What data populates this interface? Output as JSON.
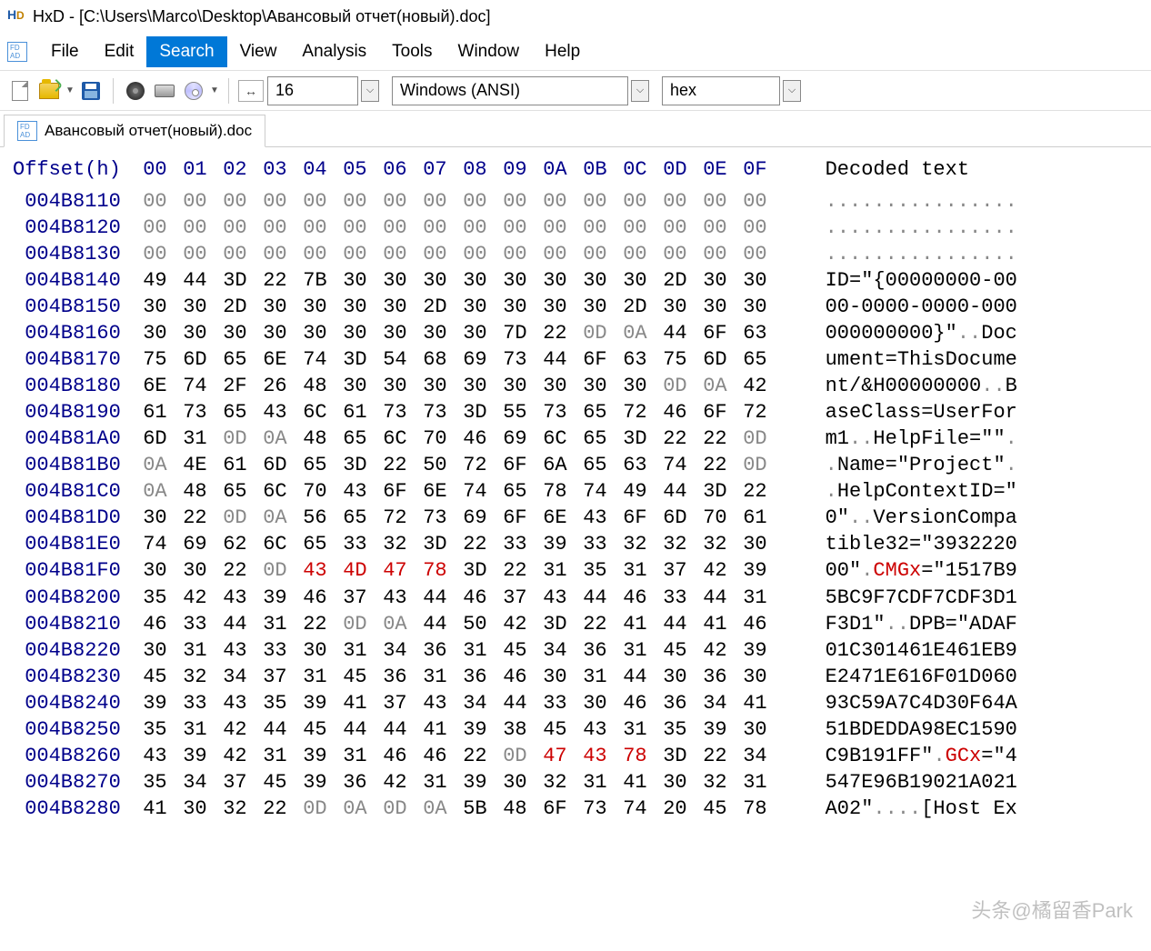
{
  "title": "HxD - [C:\\Users\\Marco\\Desktop\\Авансовый отчет(новый).doc]",
  "menu": {
    "file": "File",
    "edit": "Edit",
    "search": "Search",
    "view": "View",
    "analysis": "Analysis",
    "tools": "Tools",
    "window": "Window",
    "help": "Help"
  },
  "toolbar": {
    "bytewidth": "16",
    "encoding": "Windows (ANSI)",
    "base": "hex"
  },
  "tab": {
    "name": "Авансовый отчет(новый).doc"
  },
  "hex": {
    "offset_label": "Offset(h)",
    "columns": [
      "00",
      "01",
      "02",
      "03",
      "04",
      "05",
      "06",
      "07",
      "08",
      "09",
      "0A",
      "0B",
      "0C",
      "0D",
      "0E",
      "0F"
    ],
    "decoded_label": "Decoded text",
    "rows": [
      {
        "off": "004B8110",
        "b": [
          "00",
          "00",
          "00",
          "00",
          "00",
          "00",
          "00",
          "00",
          "00",
          "00",
          "00",
          "00",
          "00",
          "00",
          "00",
          "00"
        ],
        "d": [
          [
            ".",
            1
          ],
          [
            ".",
            1
          ],
          [
            ".",
            1
          ],
          [
            ".",
            1
          ],
          [
            ".",
            1
          ],
          [
            ".",
            1
          ],
          [
            ".",
            1
          ],
          [
            ".",
            1
          ],
          [
            ".",
            1
          ],
          [
            ".",
            1
          ],
          [
            ".",
            1
          ],
          [
            ".",
            1
          ],
          [
            ".",
            1
          ],
          [
            ".",
            1
          ],
          [
            ".",
            1
          ],
          [
            ".",
            1
          ]
        ]
      },
      {
        "off": "004B8120",
        "b": [
          "00",
          "00",
          "00",
          "00",
          "00",
          "00",
          "00",
          "00",
          "00",
          "00",
          "00",
          "00",
          "00",
          "00",
          "00",
          "00"
        ],
        "d": [
          [
            ".",
            1
          ],
          [
            ".",
            1
          ],
          [
            ".",
            1
          ],
          [
            ".",
            1
          ],
          [
            ".",
            1
          ],
          [
            ".",
            1
          ],
          [
            ".",
            1
          ],
          [
            ".",
            1
          ],
          [
            ".",
            1
          ],
          [
            ".",
            1
          ],
          [
            ".",
            1
          ],
          [
            ".",
            1
          ],
          [
            ".",
            1
          ],
          [
            ".",
            1
          ],
          [
            ".",
            1
          ],
          [
            ".",
            1
          ]
        ]
      },
      {
        "off": "004B8130",
        "b": [
          "00",
          "00",
          "00",
          "00",
          "00",
          "00",
          "00",
          "00",
          "00",
          "00",
          "00",
          "00",
          "00",
          "00",
          "00",
          "00"
        ],
        "d": [
          [
            ".",
            1
          ],
          [
            ".",
            1
          ],
          [
            ".",
            1
          ],
          [
            ".",
            1
          ],
          [
            ".",
            1
          ],
          [
            ".",
            1
          ],
          [
            ".",
            1
          ],
          [
            ".",
            1
          ],
          [
            ".",
            1
          ],
          [
            ".",
            1
          ],
          [
            ".",
            1
          ],
          [
            ".",
            1
          ],
          [
            ".",
            1
          ],
          [
            ".",
            1
          ],
          [
            ".",
            1
          ],
          [
            ".",
            1
          ]
        ]
      },
      {
        "off": "004B8140",
        "b": [
          "49",
          "44",
          "3D",
          "22",
          "7B",
          "30",
          "30",
          "30",
          "30",
          "30",
          "30",
          "30",
          "30",
          "2D",
          "30",
          "30"
        ],
        "d": [
          [
            "ID=\"{00000000-00",
            0
          ]
        ]
      },
      {
        "off": "004B8150",
        "b": [
          "30",
          "30",
          "2D",
          "30",
          "30",
          "30",
          "30",
          "2D",
          "30",
          "30",
          "30",
          "30",
          "2D",
          "30",
          "30",
          "30"
        ],
        "d": [
          [
            "00-0000-0000-000",
            0
          ]
        ]
      },
      {
        "off": "004B8160",
        "b": [
          "30",
          "30",
          "30",
          "30",
          "30",
          "30",
          "30",
          "30",
          "30",
          "7D",
          "22",
          "0D",
          "0A",
          "44",
          "6F",
          "63"
        ],
        "d": [
          [
            "000000000}\"",
            0
          ],
          [
            ".",
            1
          ],
          [
            ".",
            1
          ],
          [
            "Doc",
            0
          ]
        ]
      },
      {
        "off": "004B8170",
        "b": [
          "75",
          "6D",
          "65",
          "6E",
          "74",
          "3D",
          "54",
          "68",
          "69",
          "73",
          "44",
          "6F",
          "63",
          "75",
          "6D",
          "65"
        ],
        "d": [
          [
            "ument=ThisDocume",
            0
          ]
        ]
      },
      {
        "off": "004B8180",
        "b": [
          "6E",
          "74",
          "2F",
          "26",
          "48",
          "30",
          "30",
          "30",
          "30",
          "30",
          "30",
          "30",
          "30",
          "0D",
          "0A",
          "42"
        ],
        "d": [
          [
            "nt/&H00000000",
            0
          ],
          [
            ".",
            1
          ],
          [
            ".",
            1
          ],
          [
            "B",
            0
          ]
        ]
      },
      {
        "off": "004B8190",
        "b": [
          "61",
          "73",
          "65",
          "43",
          "6C",
          "61",
          "73",
          "73",
          "3D",
          "55",
          "73",
          "65",
          "72",
          "46",
          "6F",
          "72"
        ],
        "d": [
          [
            "aseClass=UserFor",
            0
          ]
        ]
      },
      {
        "off": "004B81A0",
        "b": [
          "6D",
          "31",
          "0D",
          "0A",
          "48",
          "65",
          "6C",
          "70",
          "46",
          "69",
          "6C",
          "65",
          "3D",
          "22",
          "22",
          "0D"
        ],
        "d": [
          [
            "m1",
            0
          ],
          [
            ".",
            1
          ],
          [
            ".",
            1
          ],
          [
            "HelpFile=\"\"",
            0
          ],
          [
            ".",
            1
          ]
        ]
      },
      {
        "off": "004B81B0",
        "b": [
          "0A",
          "4E",
          "61",
          "6D",
          "65",
          "3D",
          "22",
          "50",
          "72",
          "6F",
          "6A",
          "65",
          "63",
          "74",
          "22",
          "0D"
        ],
        "d": [
          [
            ".",
            1
          ],
          [
            "Name=\"Project\"",
            0
          ],
          [
            ".",
            1
          ]
        ]
      },
      {
        "off": "004B81C0",
        "b": [
          "0A",
          "48",
          "65",
          "6C",
          "70",
          "43",
          "6F",
          "6E",
          "74",
          "65",
          "78",
          "74",
          "49",
          "44",
          "3D",
          "22"
        ],
        "d": [
          [
            ".",
            1
          ],
          [
            "HelpContextID=\"",
            0
          ]
        ]
      },
      {
        "off": "004B81D0",
        "b": [
          "30",
          "22",
          "0D",
          "0A",
          "56",
          "65",
          "72",
          "73",
          "69",
          "6F",
          "6E",
          "43",
          "6F",
          "6D",
          "70",
          "61"
        ],
        "d": [
          [
            "0\"",
            0
          ],
          [
            ".",
            1
          ],
          [
            ".",
            1
          ],
          [
            "VersionCompa",
            0
          ]
        ]
      },
      {
        "off": "004B81E0",
        "b": [
          "74",
          "69",
          "62",
          "6C",
          "65",
          "33",
          "32",
          "3D",
          "22",
          "33",
          "39",
          "33",
          "32",
          "32",
          "32",
          "30"
        ],
        "d": [
          [
            "tible32=\"3932220",
            0
          ]
        ]
      },
      {
        "off": "004B81F0",
        "b": [
          "30",
          "30",
          "22",
          "0D",
          "43",
          "4D",
          "47",
          "78",
          "3D",
          "22",
          "31",
          "35",
          "31",
          "37",
          "42",
          "39"
        ],
        "d": [
          [
            "00\"",
            0
          ],
          [
            ".",
            1
          ],
          [
            "CMG",
            2
          ],
          [
            "x",
            2
          ],
          [
            "=\"1517B9",
            0
          ]
        ],
        "red": [
          4,
          5,
          6,
          7
        ]
      },
      {
        "off": "004B8200",
        "b": [
          "35",
          "42",
          "43",
          "39",
          "46",
          "37",
          "43",
          "44",
          "46",
          "37",
          "43",
          "44",
          "46",
          "33",
          "44",
          "31"
        ],
        "d": [
          [
            "5BC9F7CDF7CDF3D1",
            0
          ]
        ]
      },
      {
        "off": "004B8210",
        "b": [
          "46",
          "33",
          "44",
          "31",
          "22",
          "0D",
          "0A",
          "44",
          "50",
          "42",
          "3D",
          "22",
          "41",
          "44",
          "41",
          "46"
        ],
        "d": [
          [
            "F3D1\"",
            0
          ],
          [
            ".",
            1
          ],
          [
            ".",
            1
          ],
          [
            "DPB=\"ADAF",
            0
          ]
        ]
      },
      {
        "off": "004B8220",
        "b": [
          "30",
          "31",
          "43",
          "33",
          "30",
          "31",
          "34",
          "36",
          "31",
          "45",
          "34",
          "36",
          "31",
          "45",
          "42",
          "39"
        ],
        "d": [
          [
            "01C301461E461EB9",
            0
          ]
        ]
      },
      {
        "off": "004B8230",
        "b": [
          "45",
          "32",
          "34",
          "37",
          "31",
          "45",
          "36",
          "31",
          "36",
          "46",
          "30",
          "31",
          "44",
          "30",
          "36",
          "30"
        ],
        "d": [
          [
            "E2471E616F01D060",
            0
          ]
        ]
      },
      {
        "off": "004B8240",
        "b": [
          "39",
          "33",
          "43",
          "35",
          "39",
          "41",
          "37",
          "43",
          "34",
          "44",
          "33",
          "30",
          "46",
          "36",
          "34",
          "41"
        ],
        "d": [
          [
            "93C59A7C4D30F64A",
            0
          ]
        ]
      },
      {
        "off": "004B8250",
        "b": [
          "35",
          "31",
          "42",
          "44",
          "45",
          "44",
          "44",
          "41",
          "39",
          "38",
          "45",
          "43",
          "31",
          "35",
          "39",
          "30"
        ],
        "d": [
          [
            "51BDEDDA98EC1590",
            0
          ]
        ]
      },
      {
        "off": "004B8260",
        "b": [
          "43",
          "39",
          "42",
          "31",
          "39",
          "31",
          "46",
          "46",
          "22",
          "0D",
          "47",
          "43",
          "78",
          "3D",
          "22",
          "34"
        ],
        "d": [
          [
            "C9B191FF\"",
            0
          ],
          [
            ".",
            1
          ],
          [
            "GC",
            2
          ],
          [
            "x",
            2
          ],
          [
            "=\"4",
            0
          ]
        ],
        "red": [
          10,
          11,
          12
        ]
      },
      {
        "off": "004B8270",
        "b": [
          "35",
          "34",
          "37",
          "45",
          "39",
          "36",
          "42",
          "31",
          "39",
          "30",
          "32",
          "31",
          "41",
          "30",
          "32",
          "31"
        ],
        "d": [
          [
            "547E96B19021A021",
            0
          ]
        ]
      },
      {
        "off": "004B8280",
        "b": [
          "41",
          "30",
          "32",
          "22",
          "0D",
          "0A",
          "0D",
          "0A",
          "5B",
          "48",
          "6F",
          "73",
          "74",
          "20",
          "45",
          "78"
        ],
        "d": [
          [
            "A02\"",
            0
          ],
          [
            ".",
            1
          ],
          [
            ".",
            1
          ],
          [
            ".",
            1
          ],
          [
            ".",
            1
          ],
          [
            "[Host Ex",
            0
          ]
        ]
      }
    ]
  },
  "watermark": "头条@橘留香Park"
}
